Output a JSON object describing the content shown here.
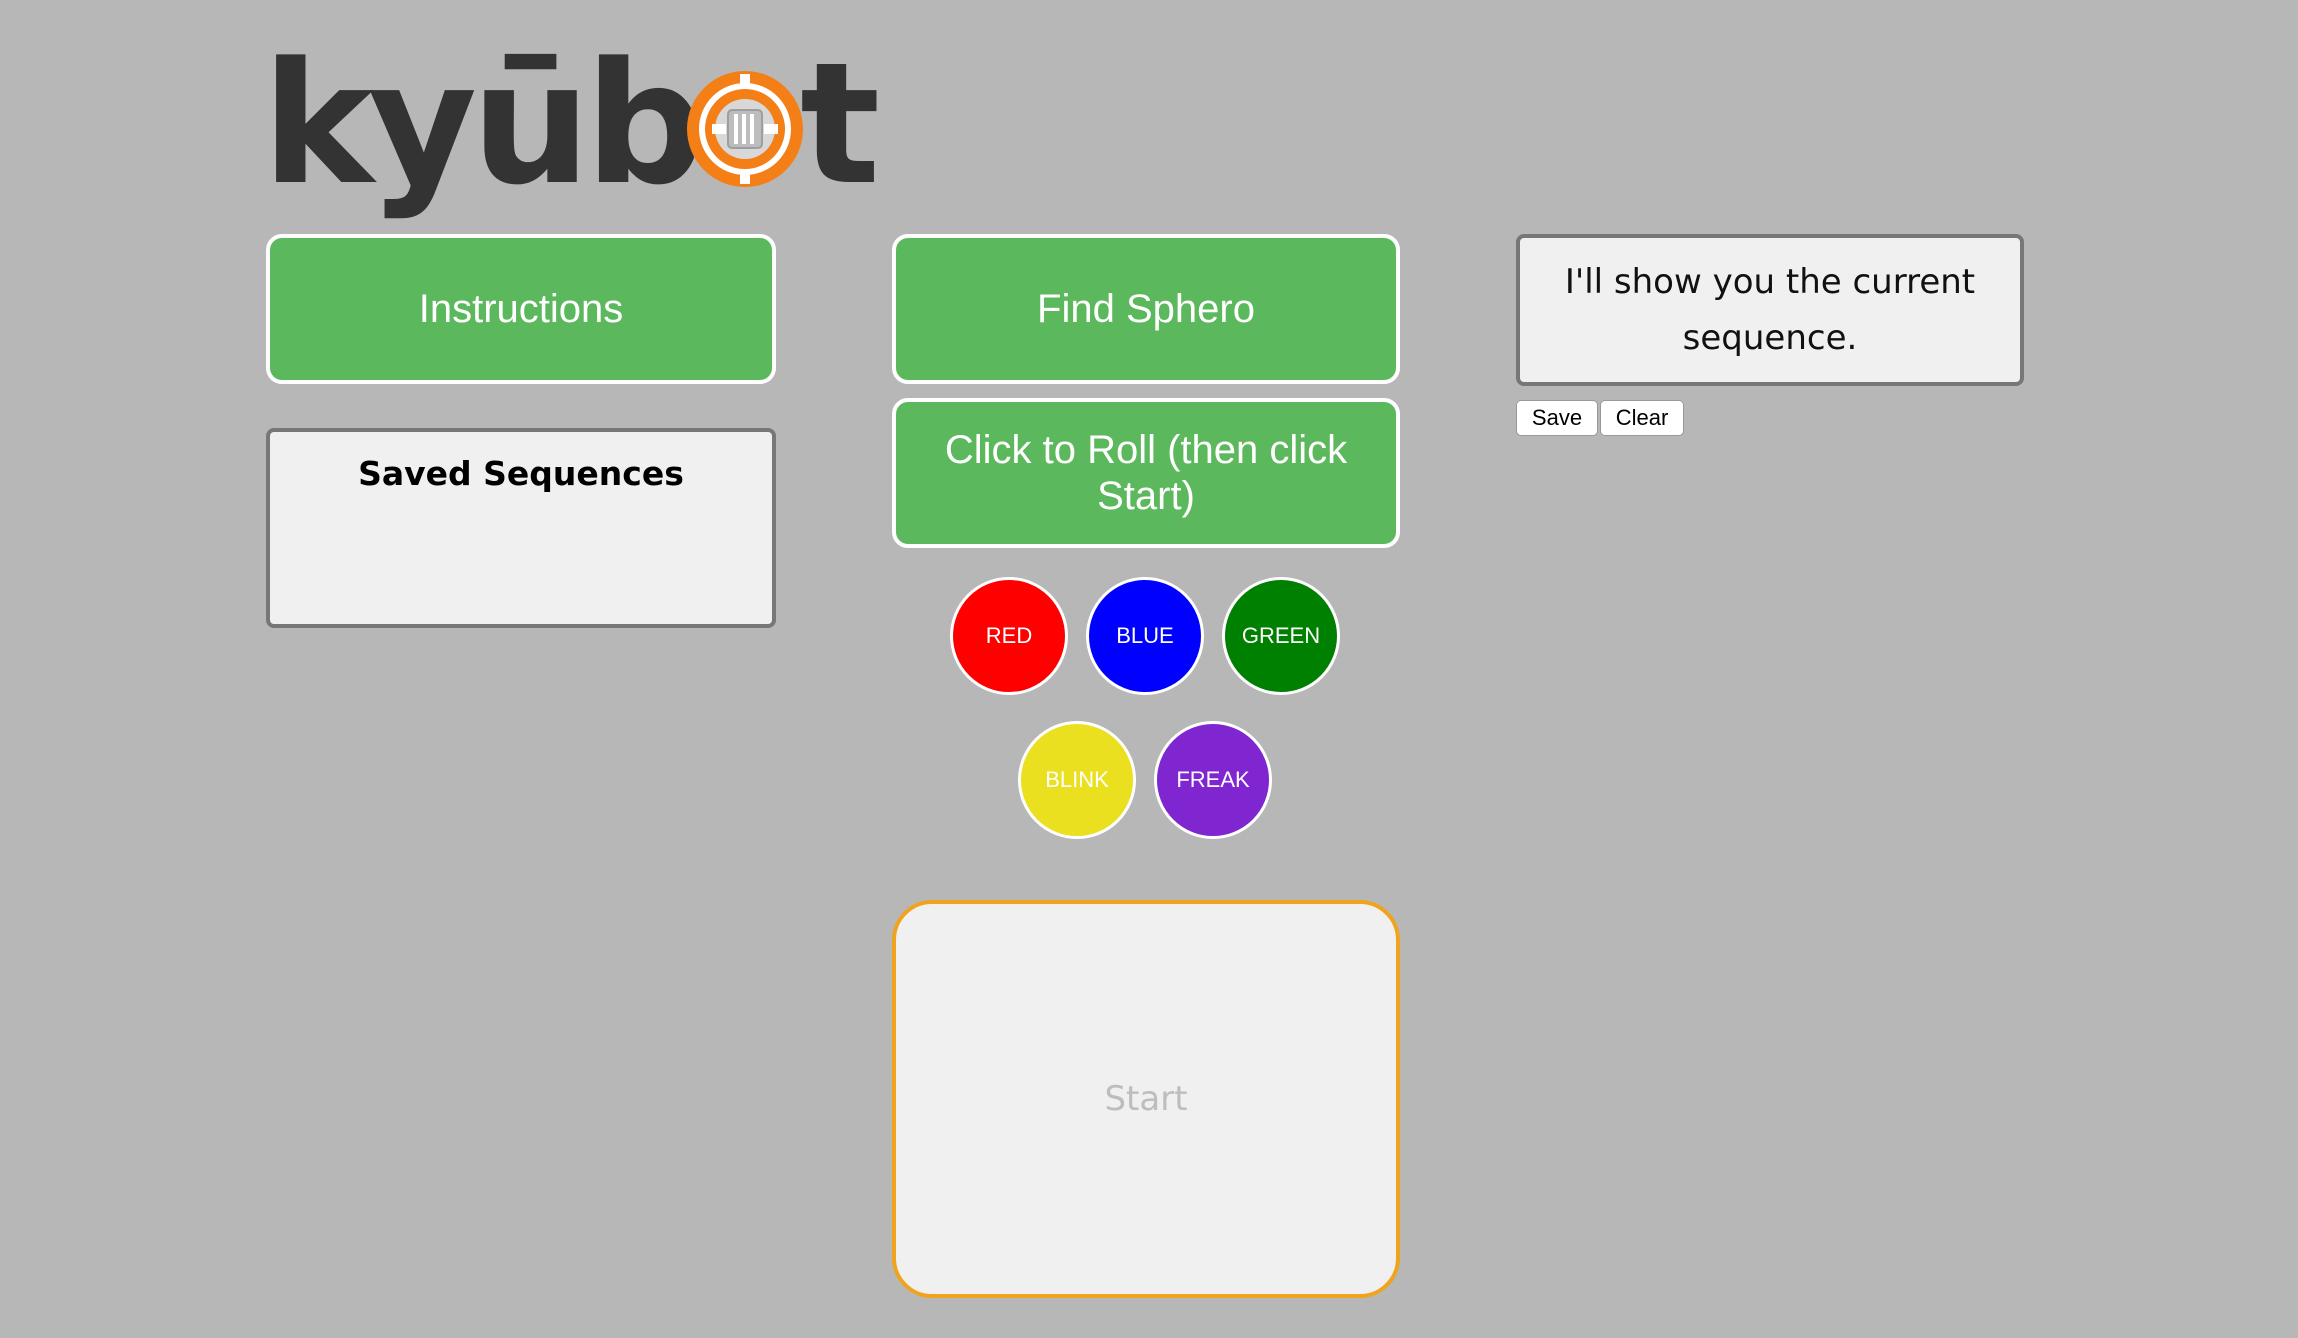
{
  "logo": {
    "text_left": "kyūb",
    "text_right": "t",
    "colors": {
      "text": "#333333",
      "ring": "#f57f17"
    }
  },
  "buttons": {
    "instructions": "Instructions",
    "find_sphero": "Find Sphero",
    "click_to_roll": "Click to Roll (then click Start)",
    "save": "Save",
    "clear": "Clear"
  },
  "saved_panel": {
    "title": "Saved Sequences"
  },
  "sequence_panel": {
    "text": "I'll show you the current sequence."
  },
  "colors": [
    {
      "label": "RED",
      "color": "#ff0000"
    },
    {
      "label": "BLUE",
      "color": "#0000ff"
    },
    {
      "label": "GREEN",
      "color": "#008000"
    },
    {
      "label": "BLINK",
      "color": "#ebe01f"
    },
    {
      "label": "FREAK",
      "color": "#7f26d1"
    }
  ],
  "start": {
    "label": "Start"
  },
  "theme": {
    "background": "#b7b7b7",
    "button_green": "#5cb85c",
    "start_border": "#f0a31c"
  }
}
